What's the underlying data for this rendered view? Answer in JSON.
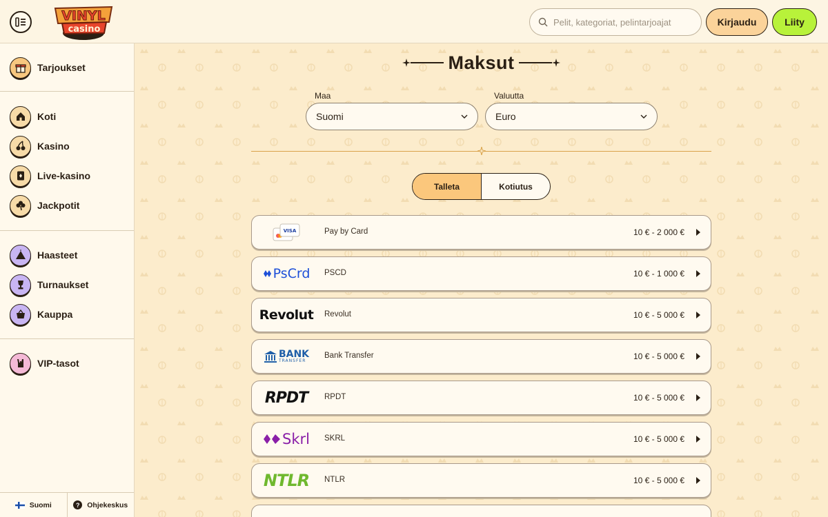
{
  "header": {
    "logo_text": "VINYL casino",
    "search_placeholder": "Pelit, kategoriat, pelintarjoajat",
    "login_label": "Kirjaudu",
    "join_label": "Liity"
  },
  "sidebar": {
    "offers": {
      "label": "Tarjoukset",
      "icon": "gift-icon",
      "color": "#f7c77f"
    },
    "items": [
      {
        "label": "Koti",
        "icon": "home-icon",
        "color": "#f7dba8"
      },
      {
        "label": "Kasino",
        "icon": "cherries-icon",
        "color": "#f7dba8"
      },
      {
        "label": "Live-kasino",
        "icon": "cards-icon",
        "color": "#f7dba8"
      },
      {
        "label": "Jackpotit",
        "icon": "clover-icon",
        "color": "#f7dba8"
      }
    ],
    "items2": [
      {
        "label": "Haasteet",
        "icon": "mountain-icon",
        "color": "#c8b5f2"
      },
      {
        "label": "Turnaukset",
        "icon": "trophy-icon",
        "color": "#c8b5f2"
      },
      {
        "label": "Kauppa",
        "icon": "basket-icon",
        "color": "#c8b5f2"
      }
    ],
    "vip": {
      "label": "VIP-tasot",
      "icon": "rock-hand-icon",
      "color": "#f4b9d6"
    },
    "footer": {
      "language": "Suomi",
      "help": "Ohjekeskus"
    }
  },
  "main": {
    "title": "Maksut",
    "country_label": "Maa",
    "country_value": "Suomi",
    "currency_label": "Valuutta",
    "currency_value": "Euro",
    "tabs": {
      "deposit": "Talleta",
      "withdraw": "Kotiutus",
      "active": "deposit"
    },
    "methods": [
      {
        "name": "Pay by Card",
        "range": "10 € - 2 000 €",
        "logo": "card"
      },
      {
        "name": "PSCD",
        "range": "10 € - 1 000 €",
        "logo": "pscrd",
        "logo_text": "PsCrd"
      },
      {
        "name": "Revolut",
        "range": "10 € - 5 000 €",
        "logo": "revolut",
        "logo_text": "Revolut"
      },
      {
        "name": "Bank Transfer",
        "range": "10 € - 5 000 €",
        "logo": "bank",
        "logo_text": "BANK",
        "logo_sub": "TRANSFER"
      },
      {
        "name": "RPDT",
        "range": "10 € - 5 000 €",
        "logo": "rpdt",
        "logo_text": "RPDT"
      },
      {
        "name": "SKRL",
        "range": "10 € - 5 000 €",
        "logo": "skrl",
        "logo_text": "Skrl"
      },
      {
        "name": "NTLR",
        "range": "10 € - 5 000 €",
        "logo": "ntlr",
        "logo_text": "NTLR"
      }
    ]
  }
}
